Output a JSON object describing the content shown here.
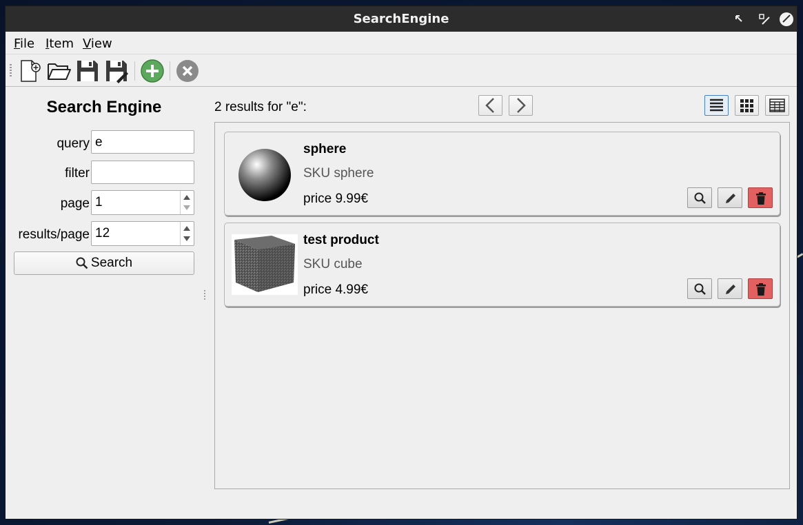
{
  "window": {
    "title": "SearchEngine"
  },
  "menubar": {
    "items": [
      {
        "label": "File",
        "mnemonic": "F",
        "rest": "ile"
      },
      {
        "label": "Item",
        "mnemonic": "I",
        "rest": "tem"
      },
      {
        "label": "View",
        "mnemonic": "V",
        "rest": "iew"
      }
    ]
  },
  "toolbar": {
    "icons": [
      "new-file-icon",
      "open-folder-icon",
      "save-icon",
      "save-as-icon",
      "add-icon",
      "close-icon"
    ]
  },
  "sidebar": {
    "title": "Search Engine",
    "query_label": "query",
    "query_value": "e",
    "filter_label": "filter",
    "filter_value": "",
    "page_label": "page",
    "page_value": "1",
    "results_per_page_label": "results/page",
    "results_per_page_value": "12",
    "search_button_label": "Search"
  },
  "results": {
    "header": "2 results for \"e\":",
    "view_modes": [
      "list-view-icon",
      "grid-view-icon",
      "table-view-icon"
    ],
    "active_view": "list",
    "items": [
      {
        "name": "sphere",
        "sku": "SKU sphere",
        "price": "price 9.99€",
        "thumbnail": "sphere-image"
      },
      {
        "name": "test product",
        "sku": "SKU cube",
        "price": "price 4.99€",
        "thumbnail": "cube-image"
      }
    ]
  },
  "colors": {
    "titlebar": "#2c2c2c",
    "window_bg": "#efefef",
    "delete_button": "#e26060",
    "add_icon": "#5ca85c",
    "active_view_border": "#4a7fc1"
  }
}
